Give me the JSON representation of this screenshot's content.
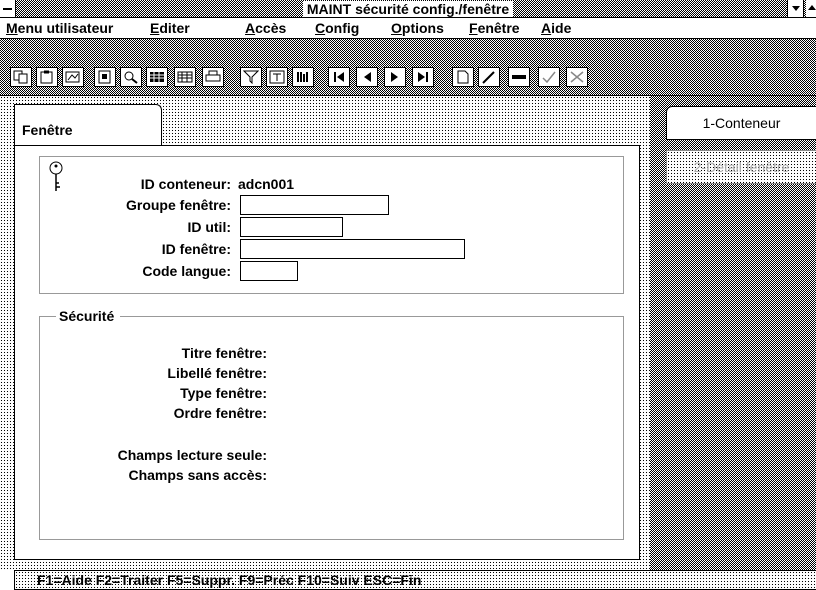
{
  "window": {
    "title": "MAINT sécurité config./fenêtre"
  },
  "menu": [
    {
      "label": "Menu utilisateur",
      "mnemonic_index": 0
    },
    {
      "label": "Editer",
      "mnemonic_index": 0
    },
    {
      "label": "Accès",
      "mnemonic_index": 0
    },
    {
      "label": "Config",
      "mnemonic_index": 0
    },
    {
      "label": "Options",
      "mnemonic_index": 0
    },
    {
      "label": "Fenêtre",
      "mnemonic_index": 0
    },
    {
      "label": "Aide",
      "mnemonic_index": 0
    }
  ],
  "toolbar": {
    "buttons": [
      {
        "icon": "copy-icon"
      },
      {
        "icon": "paste-icon"
      },
      {
        "icon": "link-icon"
      },
      {
        "icon": "document-icon"
      },
      {
        "icon": "find-icon"
      },
      {
        "icon": "grid-icon"
      },
      {
        "icon": "table-icon"
      },
      {
        "icon": "print-icon"
      },
      {
        "icon": "filter-icon"
      },
      {
        "icon": "text-icon"
      },
      {
        "icon": "columns-icon"
      },
      {
        "icon": "first-record-icon"
      },
      {
        "icon": "previous-record-icon"
      },
      {
        "icon": "next-record-icon"
      },
      {
        "icon": "last-record-icon"
      },
      {
        "icon": "new-record-icon"
      },
      {
        "icon": "edit-icon"
      },
      {
        "icon": "delete-icon"
      },
      {
        "icon": "accept-icon"
      },
      {
        "icon": "cancel-icon"
      }
    ]
  },
  "tabs": {
    "active": "Fenêtre"
  },
  "key_section": {
    "id_conteneur_label": "ID conteneur:",
    "id_conteneur_value": "adcn001",
    "groupe_fenetre_label": "Groupe fenêtre:",
    "groupe_fenetre_value": "",
    "id_util_label": "ID util:",
    "id_util_value": "",
    "id_fenetre_label": "ID fenêtre:",
    "id_fenetre_value": "",
    "code_langue_label": "Code langue:",
    "code_langue_value": ""
  },
  "security_section": {
    "legend": "Sécurité",
    "titre_label": "Titre fenêtre:",
    "libelle_label": "Libellé fenêtre:",
    "type_label": "Type fenêtre:",
    "ordre_label": "Ordre fenêtre:",
    "lecture_seule_label": "Champs lecture seule:",
    "sans_acces_label": "Champs sans accès:"
  },
  "side_buttons": {
    "conteneur": "1-Conteneur",
    "detail": "2-Détail fenêtre"
  },
  "status_bar": {
    "text": "F1=Aide  F2=Traiter  F5=Suppr.  F9=Préc  F10=Suiv  ESC=Fin"
  }
}
